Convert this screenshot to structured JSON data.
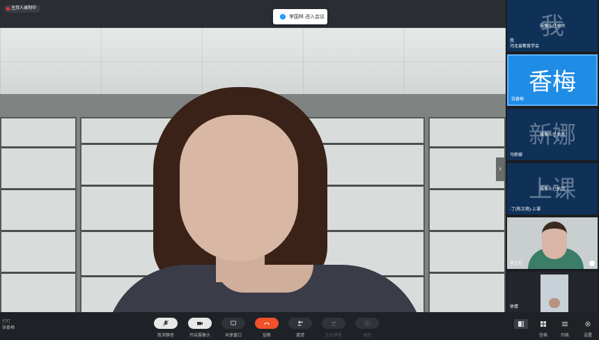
{
  "topbar": {
    "host_badge": "主持人录制中"
  },
  "toast": {
    "text": "李国林 进入会议"
  },
  "participants": [
    {
      "big": "我",
      "camera": "摄像头已关闭",
      "name": "我",
      "org": "河北省教育学会"
    },
    {
      "big": "香梅",
      "camera": "",
      "name": "张香梅",
      "org": ""
    },
    {
      "big": "新娜",
      "camera": "摄像头已关闭",
      "name": "马新娜",
      "org": ""
    },
    {
      "big": "上课",
      "camera": "摄像头已关闭",
      "name": "-丁(陈文艳)-上课",
      "org": ""
    },
    {
      "big": "",
      "camera": "",
      "name": "李文玲",
      "org": ""
    },
    {
      "big": "",
      "camera": "",
      "name": "徐倩",
      "org": ""
    }
  ],
  "self": {
    "sub": "打打",
    "name": "张香梅"
  },
  "toolbar": {
    "items": [
      {
        "label": "取消静音",
        "icon": "mic-off-icon"
      },
      {
        "label": "开启摄像头",
        "icon": "camera-icon"
      },
      {
        "label": "共享窗口",
        "icon": "share-icon"
      },
      {
        "label": "挂断",
        "icon": "hangup-icon"
      },
      {
        "label": "邀请",
        "icon": "invite-icon"
      },
      {
        "label": "全员静音",
        "icon": "mute-all-icon"
      },
      {
        "label": "录制",
        "icon": "record-icon"
      }
    ],
    "right": [
      {
        "label": "",
        "icon": "layout-icon"
      },
      {
        "label": "宫格",
        "icon": "grid-icon"
      },
      {
        "label": "列表",
        "icon": "list-icon"
      },
      {
        "label": "设置",
        "icon": "gear-icon"
      }
    ]
  },
  "colors": {
    "accent": "#1f8ce6",
    "hangup": "#f0502a",
    "tile": "#0f3158"
  }
}
